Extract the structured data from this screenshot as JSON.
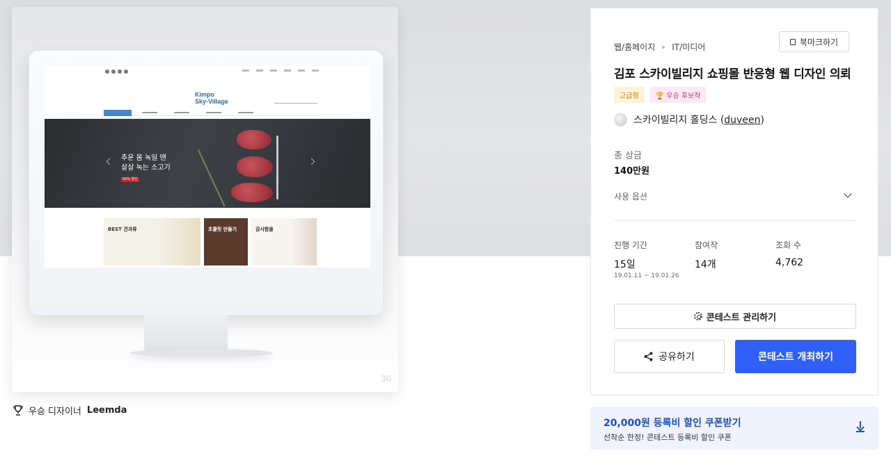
{
  "preview": {
    "count": "30",
    "mock_site": {
      "logo_line1": "Kimpo",
      "logo_line2": "Sky-Village",
      "hero_line1": "추운 몸 녹일 땐",
      "hero_line2": "살살 녹는 소고기",
      "hero_tag": "50% 할인",
      "card1_title": "BEST 견과류",
      "card2_title": "초콜릿 만들기",
      "card3_title": "감사함을"
    }
  },
  "designer": {
    "prefix": "우승 디자이너",
    "name": "Leemda"
  },
  "panel": {
    "category_main": "웹/홈페이지",
    "category_sub": "IT/미디어",
    "bookmark_label": "북마크하기",
    "title": "김포 스카이빌리지 쇼핑몰 반응형 웹 디자인 의뢰",
    "badge_grade": "고급형",
    "badge_award": "우승 후보작",
    "host_name": "스카이빌리지 홀딩스 (",
    "host_id": "duveen",
    "host_close": ")",
    "prize_label": "총 상금",
    "prize_value": "140만원",
    "options_label": "사용 옵션",
    "stats": {
      "period_label": "진행 기간",
      "period_value": "15일",
      "period_range": "19.01.11 ~ 19.01.26",
      "entries_label": "참여작",
      "entries_value": "14개",
      "views_label": "조회 수",
      "views_value": "4,762"
    },
    "manage_label": "콘테스트 관리하기",
    "share_label": "공유하기",
    "host_contest_label": "콘테스트 개최하기"
  },
  "coupon": {
    "title": "20,000원 등록비 할인 쿠폰받기",
    "subtitle": "선착순 한정! 콘테스트 등록비 할인 쿠폰"
  },
  "colors": {
    "primary": "#2f5ff4",
    "coupon_bg": "#eef3fd",
    "coupon_text": "#1f4fbd"
  }
}
